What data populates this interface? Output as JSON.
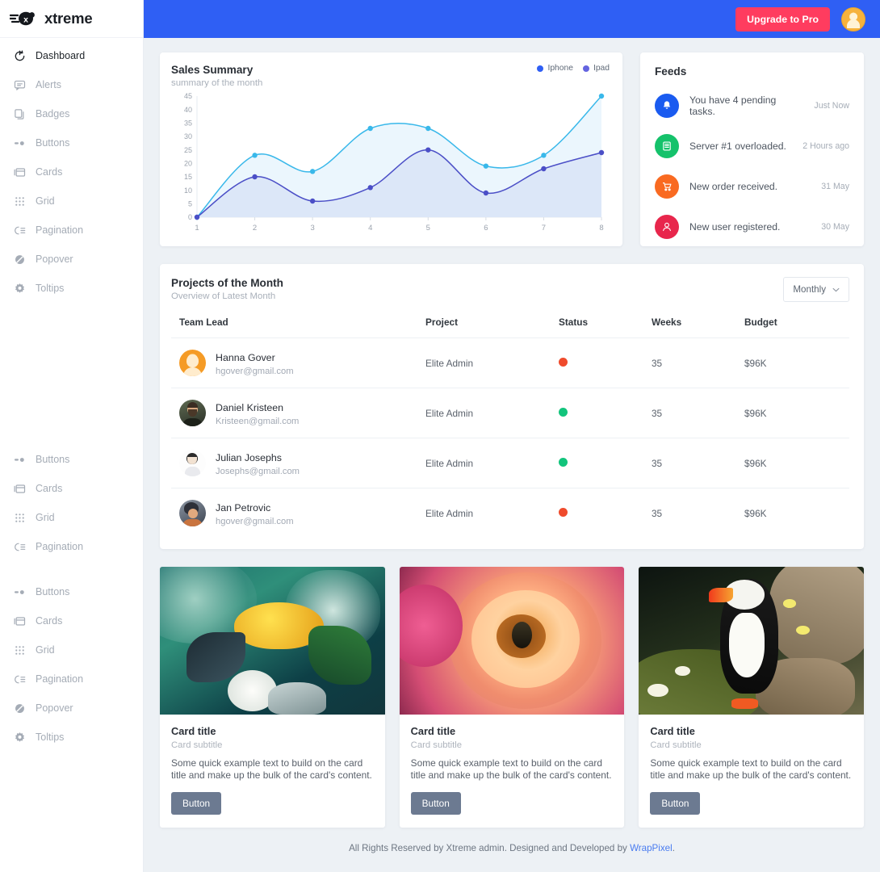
{
  "brand": {
    "name": "xtreme",
    "logo_icon": "xtreme-logo-icon"
  },
  "sidebar": {
    "items": [
      {
        "label": "Dashboard",
        "icon": "dashboard-icon",
        "active": true
      },
      {
        "label": "Alerts",
        "icon": "alert-icon",
        "active": false
      },
      {
        "label": "Badges",
        "icon": "badge-icon",
        "active": false
      },
      {
        "label": "Buttons",
        "icon": "button-icon",
        "active": false
      },
      {
        "label": "Cards",
        "icon": "card-icon",
        "active": false
      },
      {
        "label": "Grid",
        "icon": "grid-icon",
        "active": false
      },
      {
        "label": "Pagination",
        "icon": "pagination-icon",
        "active": false
      },
      {
        "label": "Popover",
        "icon": "popover-icon",
        "active": false
      },
      {
        "label": "Toltips",
        "icon": "tooltip-icon",
        "active": false
      }
    ],
    "items2": [
      {
        "label": "Buttons",
        "icon": "button-icon"
      },
      {
        "label": "Cards",
        "icon": "card-icon"
      },
      {
        "label": "Grid",
        "icon": "grid-icon"
      },
      {
        "label": "Pagination",
        "icon": "pagination-icon"
      }
    ],
    "items3": [
      {
        "label": "Buttons",
        "icon": "button-icon"
      },
      {
        "label": "Cards",
        "icon": "card-icon"
      },
      {
        "label": "Grid",
        "icon": "grid-icon"
      },
      {
        "label": "Pagination",
        "icon": "pagination-icon"
      },
      {
        "label": "Popover",
        "icon": "popover-icon"
      },
      {
        "label": "Toltips",
        "icon": "tooltip-icon"
      }
    ]
  },
  "topbar": {
    "upgrade_label": "Upgrade to Pro",
    "upgrade_color": "#ff3c5f",
    "bar_color": "#2f5ff4",
    "avatar_icon": "user-avatar"
  },
  "sales": {
    "title": "Sales Summary",
    "subtitle": "summary of the month"
  },
  "chart_data": {
    "type": "area",
    "title": "Sales Summary",
    "subtitle": "summary of the month",
    "xlabel": "",
    "ylabel": "",
    "x": [
      1,
      2,
      3,
      4,
      5,
      6,
      7,
      8
    ],
    "xticklabels": [
      "1",
      "2",
      "3",
      "4",
      "5",
      "6",
      "7",
      "8"
    ],
    "yticklabels": [
      "0",
      "5",
      "10",
      "15",
      "20",
      "25",
      "30",
      "35",
      "40",
      "45"
    ],
    "ylim": [
      0,
      45
    ],
    "grid": false,
    "legend_position": "top-right",
    "series": [
      {
        "name": "Iphone",
        "color": "#39b8ea",
        "fill": "#eaf6fd",
        "values": [
          0,
          23,
          17,
          33,
          33,
          19,
          23,
          45
        ]
      },
      {
        "name": "Ipad",
        "color": "#4b4fc7",
        "fill": "#dbe6f8",
        "values": [
          0,
          15,
          6,
          11,
          25,
          9,
          18,
          24
        ]
      }
    ]
  },
  "feeds": {
    "title": "Feeds",
    "items": [
      {
        "text": "You have 4 pending tasks.",
        "time": "Just Now",
        "icon": "bell-icon",
        "color": "#1a5bf0"
      },
      {
        "text": "Server #1 overloaded.",
        "time": "2 Hours ago",
        "icon": "server-icon",
        "color": "#15c26b"
      },
      {
        "text": "New order received.",
        "time": "31 May",
        "icon": "cart-icon",
        "color": "#f96a21"
      },
      {
        "text": "New user registered.",
        "time": "30 May",
        "icon": "user-icon",
        "color": "#e8264c"
      }
    ]
  },
  "projects": {
    "title": "Projects of the Month",
    "subtitle": "Overview of Latest Month",
    "filter_label": "Monthly",
    "columns": [
      "Team Lead",
      "Project",
      "Status",
      "Weeks",
      "Budget"
    ],
    "rows": [
      {
        "name": "Hanna Gover",
        "email": "hgover@gmail.com",
        "project": "Elite Admin",
        "status_color": "#ef4b2c",
        "weeks": "35",
        "budget": "$96K",
        "avatar": "avatar-hanna"
      },
      {
        "name": "Daniel Kristeen",
        "email": "Kristeen@gmail.com",
        "project": "Elite Admin",
        "status_color": "#12c47c",
        "weeks": "35",
        "budget": "$96K",
        "avatar": "avatar-daniel"
      },
      {
        "name": "Julian Josephs",
        "email": "Josephs@gmail.com",
        "project": "Elite Admin",
        "status_color": "#12c47c",
        "weeks": "35",
        "budget": "$96K",
        "avatar": "avatar-julian"
      },
      {
        "name": "Jan Petrovic",
        "email": "hgover@gmail.com",
        "project": "Elite Admin",
        "status_color": "#ef4b2c",
        "weeks": "35",
        "budget": "$96K",
        "avatar": "avatar-jan"
      }
    ]
  },
  "cards": [
    {
      "title": "Card title",
      "subtitle": "Card subtitle",
      "text": "Some quick example text to build on the card title and make up the bulk of the card's content.",
      "button": "Button",
      "image": "crab-photo"
    },
    {
      "title": "Card title",
      "subtitle": "Card subtitle",
      "text": "Some quick example text to build on the card title and make up the bulk of the card's content.",
      "button": "Button",
      "image": "rose-bee-photo"
    },
    {
      "title": "Card title",
      "subtitle": "Card subtitle",
      "text": "Some quick example text to build on the card title and make up the bulk of the card's content.",
      "button": "Button",
      "image": "puffin-photo"
    }
  ],
  "footer": {
    "text": "All Rights Reserved by Xtreme admin. Designed and Developed by ",
    "link": "WrapPixel",
    "period": "."
  }
}
